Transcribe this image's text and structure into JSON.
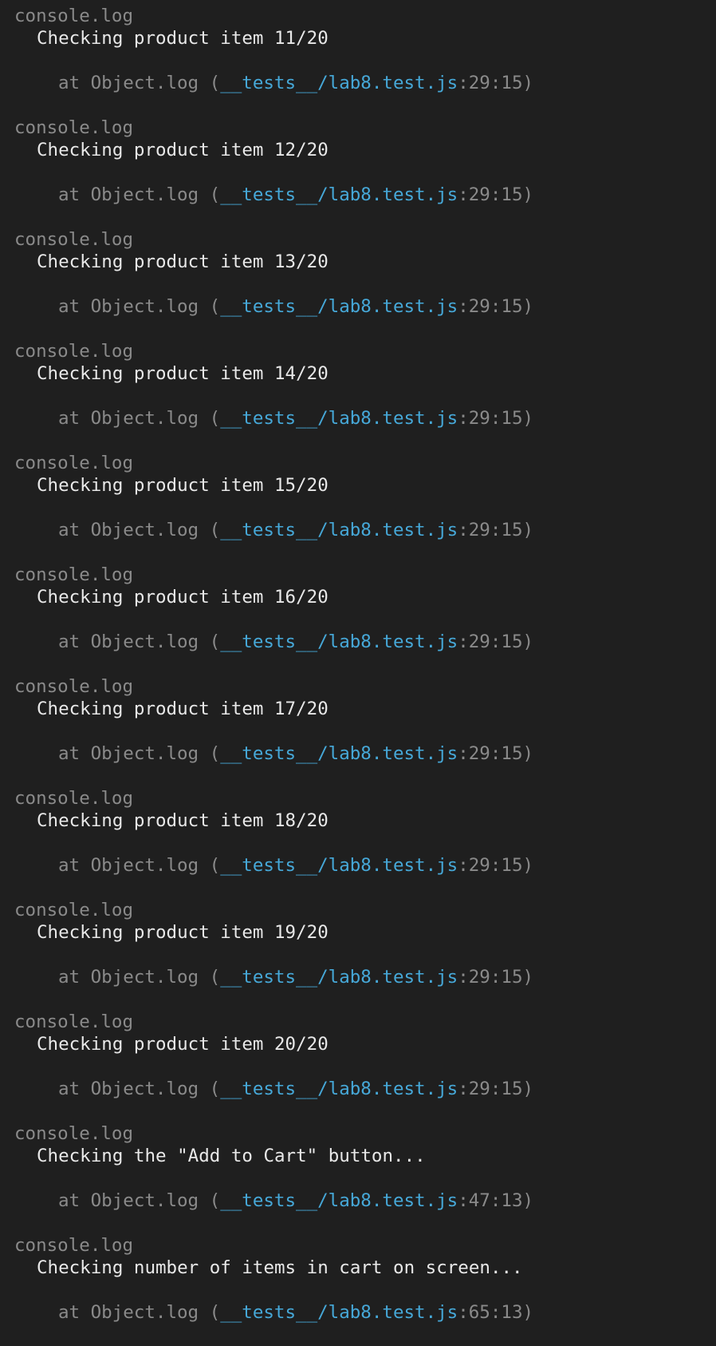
{
  "window": {
    "title": "",
    "theme": {
      "background": "#1f1f1f",
      "dim_text": "#8a8a8a",
      "bright_text": "#e8e8e8",
      "link_text": "#46a8d8"
    }
  },
  "log_entries": [
    {
      "label": "console.log",
      "message": "Checking product item 11/20",
      "trace_prefix": "at Object.log (",
      "trace_file": "__tests__/lab8.test.js",
      "trace_location": ":29:15)"
    },
    {
      "label": "console.log",
      "message": "Checking product item 12/20",
      "trace_prefix": "at Object.log (",
      "trace_file": "__tests__/lab8.test.js",
      "trace_location": ":29:15)"
    },
    {
      "label": "console.log",
      "message": "Checking product item 13/20",
      "trace_prefix": "at Object.log (",
      "trace_file": "__tests__/lab8.test.js",
      "trace_location": ":29:15)"
    },
    {
      "label": "console.log",
      "message": "Checking product item 14/20",
      "trace_prefix": "at Object.log (",
      "trace_file": "__tests__/lab8.test.js",
      "trace_location": ":29:15)"
    },
    {
      "label": "console.log",
      "message": "Checking product item 15/20",
      "trace_prefix": "at Object.log (",
      "trace_file": "__tests__/lab8.test.js",
      "trace_location": ":29:15)"
    },
    {
      "label": "console.log",
      "message": "Checking product item 16/20",
      "trace_prefix": "at Object.log (",
      "trace_file": "__tests__/lab8.test.js",
      "trace_location": ":29:15)"
    },
    {
      "label": "console.log",
      "message": "Checking product item 17/20",
      "trace_prefix": "at Object.log (",
      "trace_file": "__tests__/lab8.test.js",
      "trace_location": ":29:15)"
    },
    {
      "label": "console.log",
      "message": "Checking product item 18/20",
      "trace_prefix": "at Object.log (",
      "trace_file": "__tests__/lab8.test.js",
      "trace_location": ":29:15)"
    },
    {
      "label": "console.log",
      "message": "Checking product item 19/20",
      "trace_prefix": "at Object.log (",
      "trace_file": "__tests__/lab8.test.js",
      "trace_location": ":29:15)"
    },
    {
      "label": "console.log",
      "message": "Checking product item 20/20",
      "trace_prefix": "at Object.log (",
      "trace_file": "__tests__/lab8.test.js",
      "trace_location": ":29:15)"
    },
    {
      "label": "console.log",
      "message": "Checking the \"Add to Cart\" button...",
      "trace_prefix": "at Object.log (",
      "trace_file": "__tests__/lab8.test.js",
      "trace_location": ":47:13)"
    },
    {
      "label": "console.log",
      "message": "Checking number of items in cart on screen...",
      "trace_prefix": "at Object.log (",
      "trace_file": "__tests__/lab8.test.js",
      "trace_location": ":65:13)"
    }
  ]
}
